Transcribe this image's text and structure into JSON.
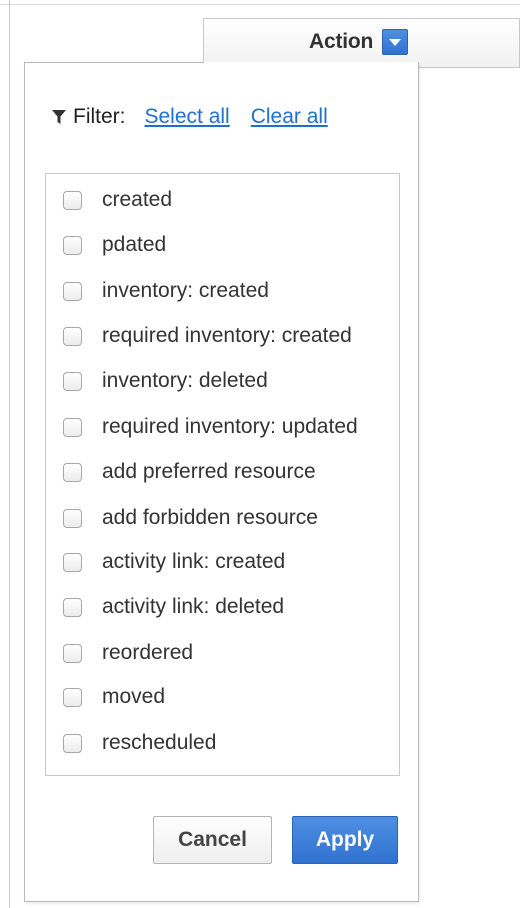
{
  "header": {
    "column_title": "Action",
    "dropdown_icon": "chevron-down-icon",
    "accent_color": "#3a7fd8"
  },
  "filter": {
    "label": "Filter:",
    "icon": "funnel-icon",
    "select_all": "Select all",
    "clear_all": "Clear all"
  },
  "items": [
    {
      "label": "created",
      "checked": false
    },
    {
      "label": "pdated",
      "checked": false
    },
    {
      "label": "inventory: created",
      "checked": false
    },
    {
      "label": "required inventory: created",
      "checked": false
    },
    {
      "label": "inventory: deleted",
      "checked": false
    },
    {
      "label": "required inventory: updated",
      "checked": false
    },
    {
      "label": "add preferred resource",
      "checked": false
    },
    {
      "label": "add forbidden resource",
      "checked": false
    },
    {
      "label": "activity link: created",
      "checked": false
    },
    {
      "label": "activity link: deleted",
      "checked": false
    },
    {
      "label": "reordered",
      "checked": false
    },
    {
      "label": "moved",
      "checked": false
    },
    {
      "label": "rescheduled",
      "checked": false
    }
  ],
  "buttons": {
    "cancel": "Cancel",
    "apply": "Apply"
  }
}
